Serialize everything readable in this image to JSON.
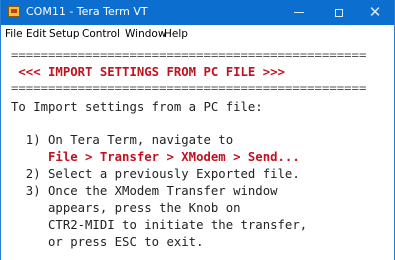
{
  "window": {
    "title": "COM11 - Tera Term VT",
    "icon": "tera-term-icon",
    "controls": {
      "minimize_icon": "minimize-icon",
      "maximize_icon": "maximize-icon",
      "close_icon": "close-icon",
      "close_glyph": "✕"
    }
  },
  "menu": {
    "items": [
      "File",
      "Edit",
      "Setup",
      "Control",
      "Window",
      "Help"
    ]
  },
  "terminal": {
    "rule_top": "================================================",
    "heading": " <<< IMPORT SETTINGS FROM PC FILE >>>",
    "rule_bottom": "================================================",
    "intro": "To Import settings from a PC file:",
    "step1": "  1) On Tera Term, navigate to",
    "step1_path": "     File > Transfer > XModem > Send...",
    "step2": "  2) Select a previously Exported file.",
    "step3_line1": "  3) Once the XModem Transfer window",
    "step3_line2": "     appears, press the Knob on",
    "step3_line3": "     CTR2-MIDI to initiate the transfer,",
    "step3_line4": "     or press ESC to exit."
  },
  "colors": {
    "titlebar": "#0c6fd0",
    "highlight_text": "#c1121f",
    "terminal_text": "#222222",
    "background": "#ffffff"
  }
}
